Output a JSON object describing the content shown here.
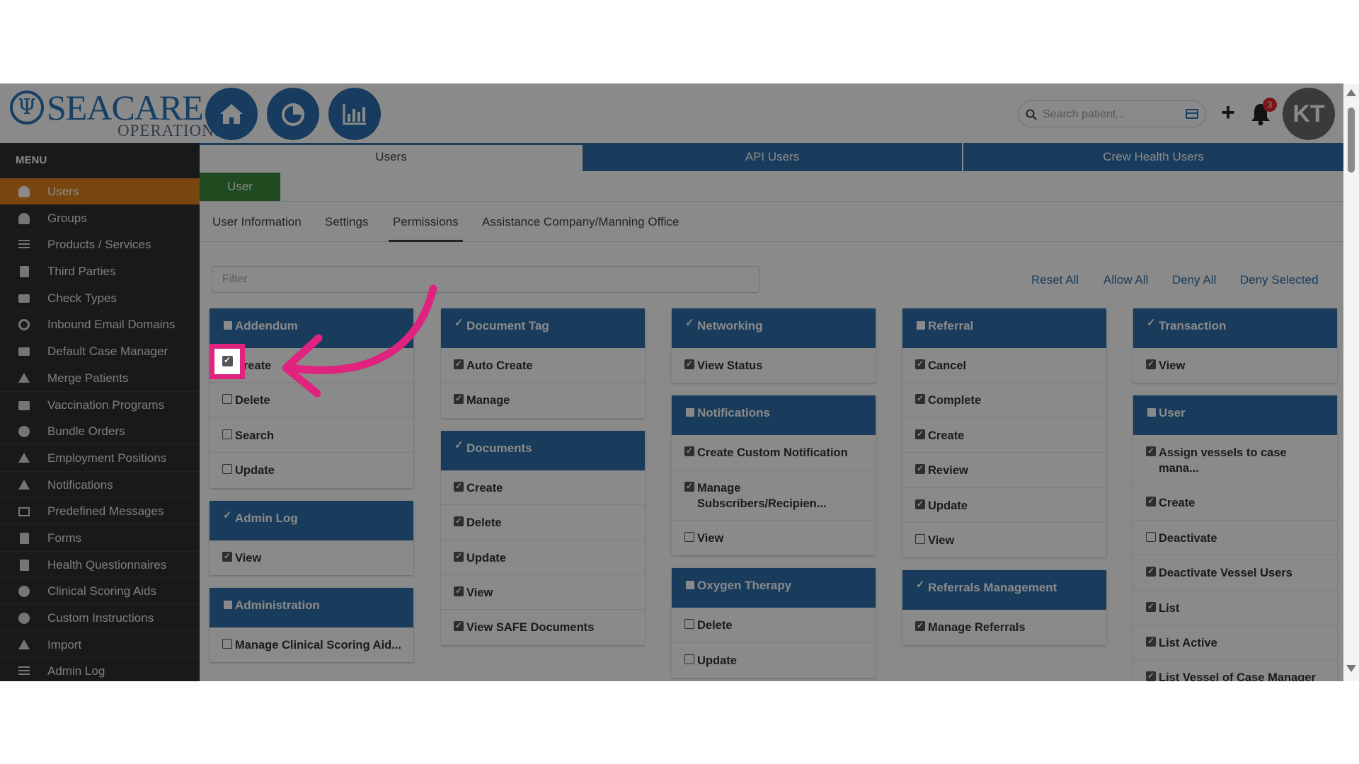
{
  "header": {
    "logo_text": "SEACARE",
    "logo_subtext": "OPERATIONS",
    "nav_buttons": [
      "home-icon",
      "pie-chart-icon",
      "bar-chart-icon"
    ],
    "search_placeholder": "Search patient...",
    "plus_symbol": "+",
    "notification_count": "3",
    "avatar_initials": "KT"
  },
  "sidebar": {
    "title": "MENU",
    "items": [
      {
        "label": "Users",
        "icon": "user-icon",
        "active": true
      },
      {
        "label": "Groups",
        "icon": "group-icon"
      },
      {
        "label": "Products / Services",
        "icon": "list-icon"
      },
      {
        "label": "Third Parties",
        "icon": "building-icon"
      },
      {
        "label": "Check Types",
        "icon": "money-icon"
      },
      {
        "label": "Inbound Email Domains",
        "icon": "at-icon"
      },
      {
        "label": "Default Case Manager",
        "icon": "id-card-icon"
      },
      {
        "label": "Merge Patients",
        "icon": "compress-icon"
      },
      {
        "label": "Vaccination Programs",
        "icon": "briefcase-icon"
      },
      {
        "label": "Bundle Orders",
        "icon": "stethoscope-icon"
      },
      {
        "label": "Employment Positions",
        "icon": "wrench-icon"
      },
      {
        "label": "Notifications",
        "icon": "megaphone-icon"
      },
      {
        "label": "Predefined Messages",
        "icon": "envelope-icon"
      },
      {
        "label": "Forms",
        "icon": "file-icon"
      },
      {
        "label": "Health Questionnaires",
        "icon": "clipboard-icon"
      },
      {
        "label": "Clinical Scoring Aids",
        "icon": "info-icon"
      },
      {
        "label": "Custom Instructions",
        "icon": "info-icon"
      },
      {
        "label": "Import",
        "icon": "upload-icon"
      },
      {
        "label": "Admin Log",
        "icon": "sort-icon"
      }
    ]
  },
  "top_tabs": [
    {
      "label": "Users",
      "active": true
    },
    {
      "label": "API Users",
      "active": false
    },
    {
      "label": "Crew Health Users",
      "active": false
    }
  ],
  "user_chip": "User",
  "sub_tabs": [
    {
      "label": "User Information",
      "active": false
    },
    {
      "label": "Settings",
      "active": false
    },
    {
      "label": "Permissions",
      "active": true
    },
    {
      "label": "Assistance Company/Manning Office",
      "active": false
    }
  ],
  "filter_placeholder": "Filter",
  "actions": [
    "Reset All",
    "Allow All",
    "Deny All",
    "Deny Selected"
  ],
  "columns": [
    [
      {
        "title": "Addendum",
        "header_checked": false,
        "rows": [
          {
            "label": "Create",
            "checked": true
          },
          {
            "label": "Delete",
            "checked": false
          },
          {
            "label": "Search",
            "checked": false
          },
          {
            "label": "Update",
            "checked": false
          }
        ]
      },
      {
        "title": "Admin Log",
        "header_checked": true,
        "rows": [
          {
            "label": "View",
            "checked": true
          }
        ]
      },
      {
        "title": "Administration",
        "header_checked": false,
        "rows": [
          {
            "label": "Manage Clinical Scoring Aid...",
            "checked": false
          }
        ]
      }
    ],
    [
      {
        "title": "Document Tag",
        "header_checked": true,
        "rows": [
          {
            "label": "Auto Create",
            "checked": true
          },
          {
            "label": "Manage",
            "checked": true
          }
        ]
      },
      {
        "title": "Documents",
        "header_checked": true,
        "rows": [
          {
            "label": "Create",
            "checked": true
          },
          {
            "label": "Delete",
            "checked": true
          },
          {
            "label": "Update",
            "checked": true
          },
          {
            "label": "View",
            "checked": true
          },
          {
            "label": "View SAFE Documents",
            "checked": true
          }
        ]
      }
    ],
    [
      {
        "title": "Networking",
        "header_checked": true,
        "rows": [
          {
            "label": "View Status",
            "checked": true
          }
        ]
      },
      {
        "title": "Notifications",
        "header_checked": false,
        "rows": [
          {
            "label": "Create Custom Notification",
            "checked": true
          },
          {
            "label": "Manage Subscribers/Recipien...",
            "checked": true
          },
          {
            "label": "View",
            "checked": false
          }
        ]
      },
      {
        "title": "Oxygen Therapy",
        "header_checked": false,
        "rows": [
          {
            "label": "Delete",
            "checked": false
          },
          {
            "label": "Update",
            "checked": false
          }
        ]
      }
    ],
    [
      {
        "title": "Referral",
        "header_checked": false,
        "rows": [
          {
            "label": "Cancel",
            "checked": true
          },
          {
            "label": "Complete",
            "checked": true
          },
          {
            "label": "Create",
            "checked": true
          },
          {
            "label": "Review",
            "checked": true
          },
          {
            "label": "Update",
            "checked": true
          },
          {
            "label": "View",
            "checked": false
          }
        ]
      },
      {
        "title": "Referrals Management",
        "header_checked": true,
        "rows": [
          {
            "label": "Manage Referrals",
            "checked": true
          }
        ]
      }
    ],
    [
      {
        "title": "Transaction",
        "header_checked": true,
        "rows": [
          {
            "label": "View",
            "checked": true
          }
        ]
      },
      {
        "title": "User",
        "header_checked": false,
        "rows": [
          {
            "label": "Assign vessels to case mana...",
            "checked": true
          },
          {
            "label": "Create",
            "checked": true
          },
          {
            "label": "Deactivate",
            "checked": false
          },
          {
            "label": "Deactivate Vessel Users",
            "checked": true
          },
          {
            "label": "List",
            "checked": true
          },
          {
            "label": "List Active",
            "checked": true
          },
          {
            "label": "List Vessel of Case Manager",
            "checked": true
          }
        ]
      }
    ]
  ],
  "colors": {
    "primary_blue": "#2f6fab",
    "active_orange": "#e0811e",
    "chip_green": "#3c8a3c",
    "highlight_pink": "#e0237e",
    "sidebar_bg": "#2f2f2f"
  }
}
